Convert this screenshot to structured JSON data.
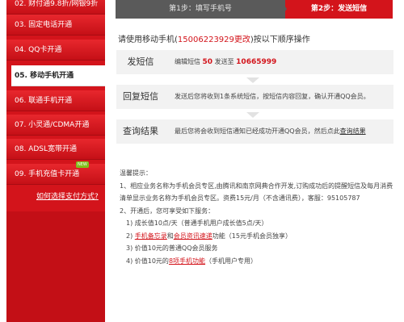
{
  "sidebar": {
    "items": [
      {
        "label": "02. 财付通9.8折/网银9折"
      },
      {
        "label": "03. 固定电话开通"
      },
      {
        "label": "04. QQ卡开通"
      },
      {
        "label": "05. 移动手机开通"
      },
      {
        "label": "06. 联通手机开通"
      },
      {
        "label": "07. 小灵通/CDMA开通"
      },
      {
        "label": "08. ADSL宽带开通"
      },
      {
        "label": "09. 手机充值卡开通",
        "badge": "NEW"
      }
    ],
    "help_link": "如何选择支付方式?"
  },
  "steps": {
    "step1": "第1步：填写手机号",
    "step2": "第2步：发送短信"
  },
  "instruction": {
    "prefix": "请使用移动手机(",
    "phone": "15006223929",
    "change": "更改",
    "suffix": ")按以下顺序操作"
  },
  "rows": {
    "send": {
      "label": "发短信",
      "t1": "编辑短信 ",
      "code": "50",
      "t2": " 发送至 ",
      "number": "10665999"
    },
    "reply": {
      "label": "回复短信",
      "text": "发送后您将收到1条系统短信，按短信内容回复，确认开通QQ会员。"
    },
    "result": {
      "label": "查询结果",
      "text": "最后您将会收到短信通知已经成功开通QQ会员，然后点此",
      "link": "查询结果"
    }
  },
  "tips": {
    "title": "温馨提示：",
    "p1": "1、相应业务名称为手机会员专区,由腾讯和南京网典合作开发,订购成功后的提醒短信及每月消费清单显示业务名称为手机会员专区。资费15元/月（不含通讯费），客服：95105787",
    "p2": "2、开通后，您可享受如下服务：",
    "i1": "1) 成长值10点/天（普通手机用户成长值5点/天）",
    "i2a": "2) ",
    "i2_link1": "手机备忘录",
    "i2b": "和",
    "i2_link2": "会员资讯速递",
    "i2c": "功能（15元手机会员独享）",
    "i3": "3) 价值10元的普通QQ会员服务",
    "i4a": "4) 价值10元的",
    "i4_link": "8项手机功能",
    "i4b": "（手机用户专用）"
  },
  "colors": {
    "accent": "#d3141b",
    "step_bg": "#5a5a5a",
    "row_bg": "#f2f2f2"
  }
}
